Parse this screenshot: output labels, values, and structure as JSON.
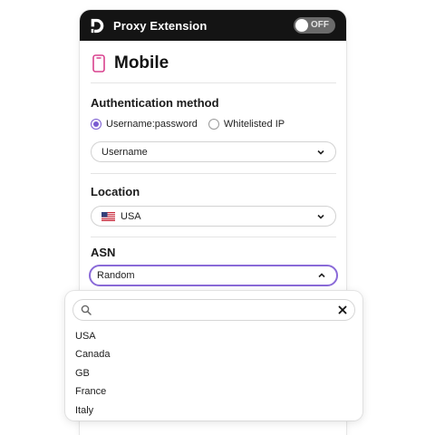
{
  "header": {
    "title": "Proxy Extension",
    "toggle_label": "OFF",
    "toggle_on": false
  },
  "page": {
    "title": "Mobile"
  },
  "auth": {
    "label": "Authentication method",
    "options": [
      "Username:password",
      "Whitelisted IP"
    ],
    "selected": "Username:password",
    "select_value": "Username"
  },
  "location": {
    "label": "Location",
    "value": "USA",
    "flag_icon": "us-flag-icon"
  },
  "asn": {
    "label": "ASN",
    "value": "Random",
    "search_placeholder": "",
    "options": [
      "USA",
      "Canada",
      "GB",
      "France",
      "Italy"
    ]
  },
  "colors": {
    "accent": "#7a5cd1",
    "header_bg": "#141414",
    "phone_icon": "#d9418e"
  }
}
